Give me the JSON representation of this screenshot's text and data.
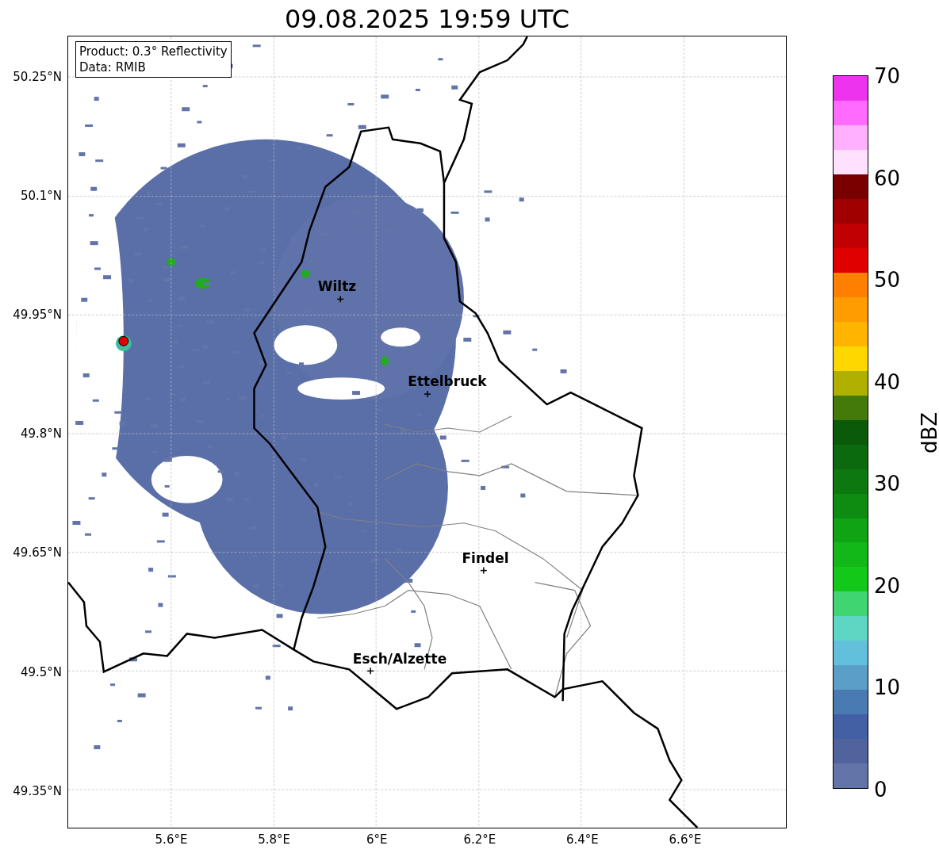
{
  "title": "09.08.2025 19:59 UTC",
  "info_box": [
    "Product: 0.3° Reflectivity",
    "Data: RMIB"
  ],
  "map": {
    "yticks": [
      "50.25°N",
      "50.1°N",
      "49.95°N",
      "49.8°N",
      "49.65°N",
      "49.5°N",
      "49.35°N"
    ],
    "xticks": [
      "5.6°E",
      "5.8°E",
      "6°E",
      "6.2°E",
      "6.4°E",
      "6.6°E"
    ],
    "places": [
      {
        "name": "Wiltz"
      },
      {
        "name": "Ettelbruck"
      },
      {
        "name": "Findel"
      },
      {
        "name": "Esch/Alzette"
      }
    ]
  },
  "colorbar": {
    "label": "dBZ",
    "ticks": [
      "70",
      "60",
      "50",
      "40",
      "30",
      "20",
      "10",
      "0"
    ],
    "bins": [
      {
        "color": "#6374a8"
      },
      {
        "color": "#50639d"
      },
      {
        "color": "#4360a5"
      },
      {
        "color": "#4a7ab2"
      },
      {
        "color": "#5b9fc8"
      },
      {
        "color": "#63c0dc"
      },
      {
        "color": "#5ed6c4"
      },
      {
        "color": "#3fd672"
      },
      {
        "color": "#14c81a"
      },
      {
        "color": "#12b818"
      },
      {
        "color": "#10a414"
      },
      {
        "color": "#0e8c12"
      },
      {
        "color": "#0d780f"
      },
      {
        "color": "#0a6a0d"
      },
      {
        "color": "#0a5a0a"
      },
      {
        "color": "#437a0a"
      },
      {
        "color": "#b0b000"
      },
      {
        "color": "#ffd700"
      },
      {
        "color": "#ffb400"
      },
      {
        "color": "#ff9c00"
      },
      {
        "color": "#ff7f00"
      },
      {
        "color": "#e00000"
      },
      {
        "color": "#c00000"
      },
      {
        "color": "#a00000"
      },
      {
        "color": "#7a0000"
      },
      {
        "color": "#ffe0ff"
      },
      {
        "color": "#ffb0ff"
      },
      {
        "color": "#ff6aff"
      },
      {
        "color": "#ee33ee"
      }
    ]
  }
}
